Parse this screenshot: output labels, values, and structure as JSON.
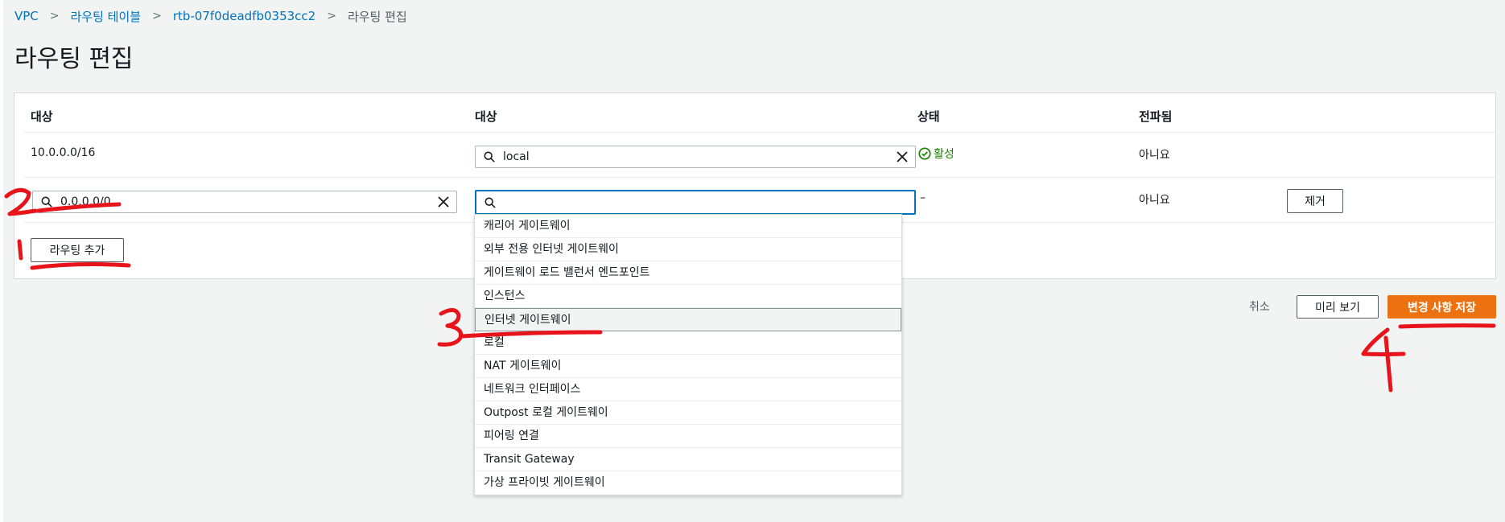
{
  "breadcrumb": {
    "items": [
      "VPC",
      "라우팅 테이블",
      "rtb-07f0deadfb0353cc2"
    ],
    "current": "라우팅 편집"
  },
  "page": {
    "title": "라우팅 편집"
  },
  "table": {
    "headers": [
      "대상",
      "대상",
      "상태",
      "전파됨"
    ],
    "rows": [
      {
        "destination": "10.0.0.0/16",
        "target": "local",
        "status": "활성",
        "propagated": "아니요"
      },
      {
        "destination": "0.0.0.0/0",
        "target": "",
        "status": "–",
        "propagated": "아니요",
        "remove_label": "제거"
      }
    ],
    "add_route_label": "라우팅 추가"
  },
  "dropdown": {
    "options": [
      "캐리어 게이트웨이",
      "외부 전용 인터넷 게이트웨이",
      "게이트웨이 로드 밸런서 엔드포인트",
      "인스턴스",
      "인터넷 게이트웨이",
      "로컬",
      "NAT 게이트웨이",
      "네트워크 인터페이스",
      "Outpost 로컬 게이트웨이",
      "피어링 연결",
      "Transit Gateway",
      "가상 프라이빗 게이트웨이"
    ],
    "highlighted": "인터넷 게이트웨이"
  },
  "footer": {
    "cancel_label": "취소",
    "preview_label": "미리 보기",
    "save_label": "변경 사항 저장"
  },
  "colors": {
    "accent_orange": "#ec7211",
    "link_blue": "#0073bb",
    "success_green": "#1d8102",
    "annotation_red": "#e8141b"
  },
  "annotations": [
    "1",
    "2",
    "3",
    "4"
  ]
}
